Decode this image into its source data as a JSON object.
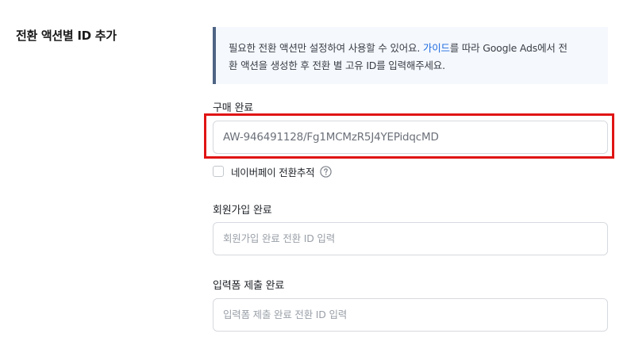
{
  "section": {
    "title": "전환 액션별 ID 추가"
  },
  "info": {
    "line1_before": "필요한 전환 액션만 설정하여 사용할 수 있어요.  ",
    "link": "가이드",
    "line1_after": "를 따라 Google Ads에서 전",
    "line2": "환 액션을 생성한 후 전환 별 고유 ID를 입력해주세요."
  },
  "fields": {
    "purchase": {
      "label": "구매 완료",
      "value": "AW-946491128/Fg1MCMzR5J4YEPidqcMD",
      "placeholder": ""
    },
    "naverpay": {
      "label": "네이버페이 전환추적",
      "checked": false
    },
    "signup": {
      "label": "회원가입 완료",
      "value": "",
      "placeholder": "회원가입 완료 전환 ID 입력"
    },
    "form_submit": {
      "label": "입력폼 제출 완료",
      "value": "",
      "placeholder": "입력폼 제출 완료 전환 ID 입력"
    }
  },
  "colors": {
    "info_bg": "#f5f8fd",
    "info_border": "#4e6485",
    "link": "#1b6ae0",
    "highlight": "#e01414"
  },
  "icons": {
    "help": "question-circle-icon"
  }
}
